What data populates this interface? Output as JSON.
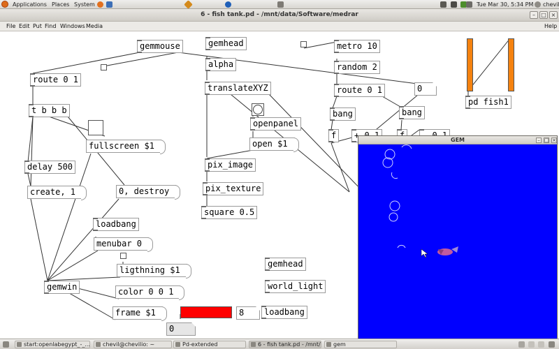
{
  "top_panel": {
    "menus": [
      "Applications",
      "Places",
      "System"
    ],
    "datetime": "Tue Mar 30,  5:34 PM",
    "user": "chevil"
  },
  "window": {
    "title": "6 - fish tank.pd  - /mnt/data/Software/medrar",
    "menu_items": [
      "File",
      "Edit",
      "Put",
      "Find",
      "Windows",
      "Media"
    ],
    "help": "Help"
  },
  "patch": {
    "objects": [
      {
        "name": "gemmouse",
        "text": "gemmouse"
      },
      {
        "name": "gemhead",
        "text": "gemhead"
      },
      {
        "name": "alpha",
        "text": "alpha"
      },
      {
        "name": "translateXYZ",
        "text": "translateXYZ"
      },
      {
        "name": "metro",
        "text": "metro 10"
      },
      {
        "name": "random",
        "text": "random 2"
      },
      {
        "name": "route-a",
        "text": "route 0 1"
      },
      {
        "name": "route-b",
        "text": "route 0 1"
      },
      {
        "name": "tbbb",
        "text": "t b b b"
      },
      {
        "name": "pd-fish1",
        "text": "pd fish1"
      },
      {
        "name": "openpanel",
        "text": "openpanel"
      },
      {
        "name": "bang-obj-a",
        "text": "bang"
      },
      {
        "name": "bang-obj-b",
        "text": "bang"
      },
      {
        "name": "f-a",
        "text": "f"
      },
      {
        "name": "plus",
        "text": "+ 0.1"
      },
      {
        "name": "f-b",
        "text": "f"
      },
      {
        "name": "minus",
        "text": "- 0.1"
      },
      {
        "name": "pix_image",
        "text": "pix_image"
      },
      {
        "name": "delay",
        "text": "delay 500"
      },
      {
        "name": "pix_texture",
        "text": "pix_texture"
      },
      {
        "name": "square",
        "text": "square 0.5"
      },
      {
        "name": "loadbang-a",
        "text": "loadbang"
      },
      {
        "name": "gemhead-b",
        "text": "gemhead"
      },
      {
        "name": "world_light",
        "text": "world_light"
      },
      {
        "name": "gemwin",
        "text": "gemwin"
      },
      {
        "name": "loadbang-b",
        "text": "loadbang"
      }
    ],
    "messages": [
      {
        "name": "fullscreen",
        "text": "fullscreen $1"
      },
      {
        "name": "open",
        "text": "open $1"
      },
      {
        "name": "create",
        "text": "create, 1"
      },
      {
        "name": "destroy",
        "text": "0, destroy"
      },
      {
        "name": "menubar",
        "text": "menubar 0"
      },
      {
        "name": "lighting",
        "text": "ligthning $1"
      },
      {
        "name": "color",
        "text": "color 0 0 1"
      },
      {
        "name": "frame",
        "text": "frame $1"
      }
    ],
    "numbers": {
      "n0": "0",
      "n8": "8",
      "n_bottom": "0"
    },
    "colors": {
      "slider": "#f5820f",
      "hslider": "#ff0000",
      "scene_bg": "#0000ff",
      "fish": "#c05aa0"
    }
  },
  "gem_window": {
    "title": "GEM"
  },
  "taskbar": {
    "tasks": [
      "start:openlabegypt_-_...",
      "chevil@chevilio: ~",
      "Pd-extended",
      "6 - fish tank.pd - /mnt/...",
      "gem"
    ]
  }
}
